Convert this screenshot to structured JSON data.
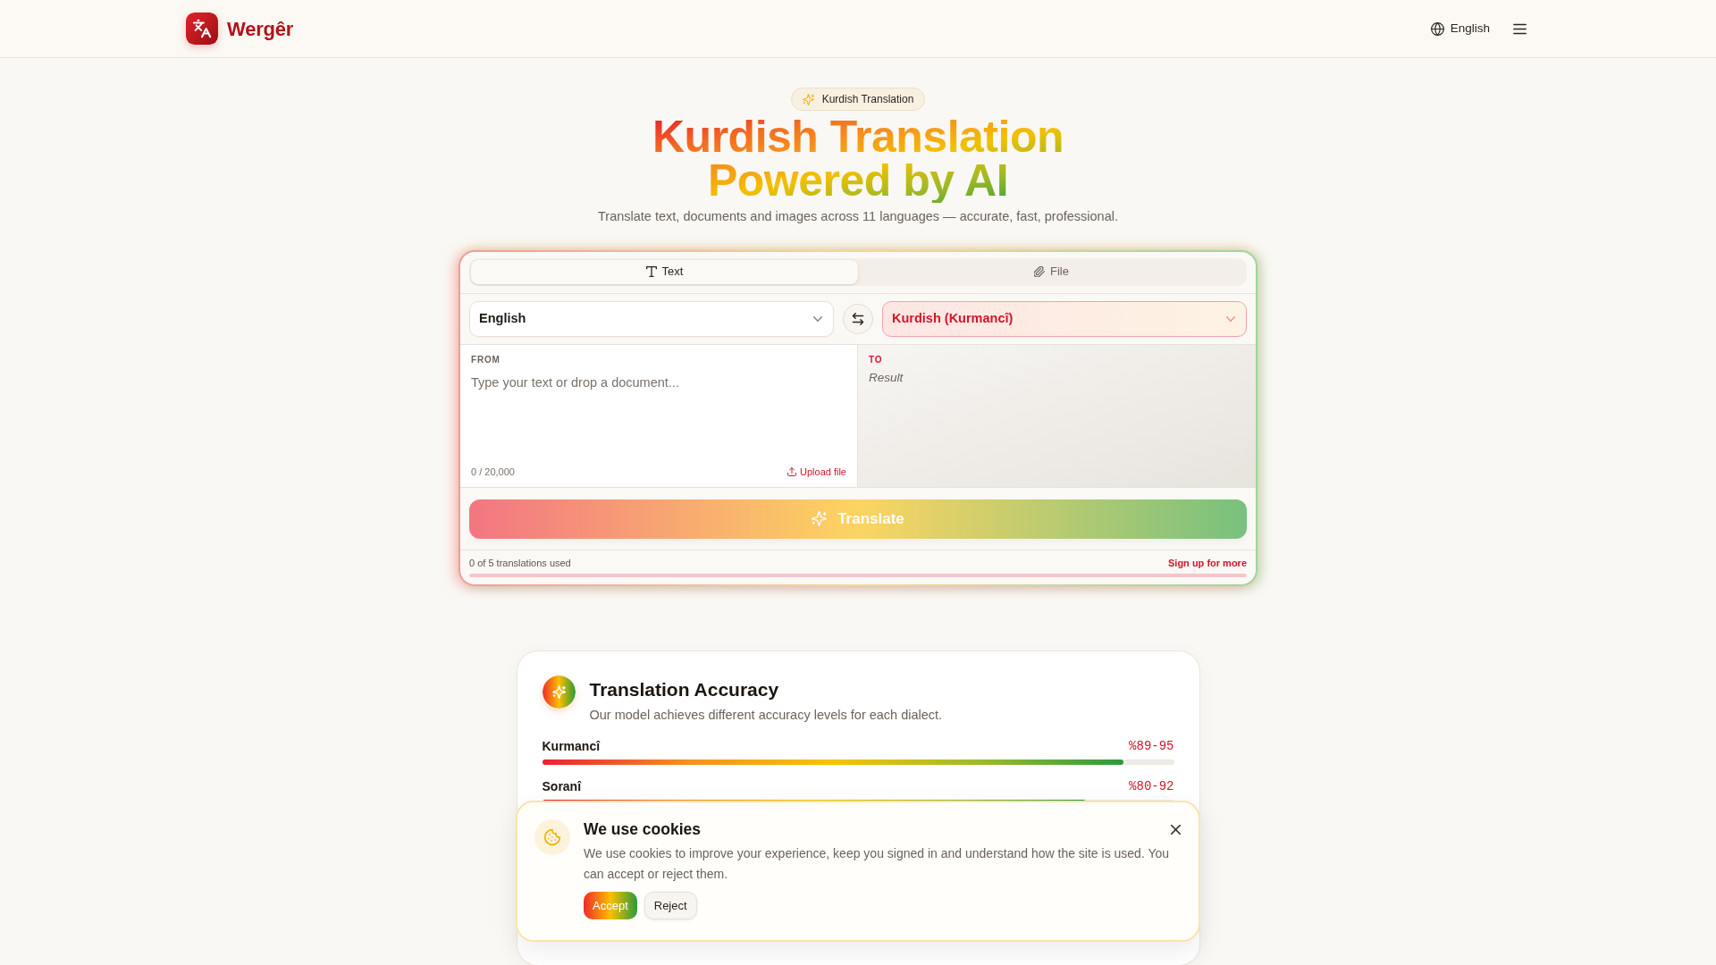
{
  "header": {
    "brand": "Wergêr",
    "language": "English"
  },
  "hero": {
    "badge": "Kurdish Translation",
    "title": "Kurdish Translation Powered by AI",
    "subtitle": "Translate text, documents and images across 11 languages — accurate, fast, professional."
  },
  "translator": {
    "tabs": [
      {
        "label": "Text",
        "kind": "text",
        "selected": true
      },
      {
        "label": "File",
        "kind": "file",
        "selected": false
      }
    ],
    "source_language": "English",
    "target_language": "Kurdish (Kurmancî)",
    "source_panel": {
      "label": "FROM",
      "placeholder": "Type your text or drop a document...",
      "counter": "0 / 20,000",
      "upload": "Upload file"
    },
    "target_panel": {
      "label": "TO",
      "placeholder": "Result"
    },
    "translate_button": {
      "label": "Translate",
      "disabled": true
    },
    "usage": {
      "text": "0 of 5 translations used",
      "link": "Sign up for more",
      "level": 0
    }
  },
  "accuracy": {
    "title": "Translation Accuracy",
    "subtitle": "Our model achieves different accuracy levels for each dialect.",
    "dialects": [
      {
        "name": "Kurmancî",
        "range": "%89-95",
        "level": 0.92
      },
      {
        "name": "Soranî",
        "range": "%80-92",
        "level": 0.86
      }
    ]
  },
  "cookie_banner": {
    "title": "We use cookies",
    "text": "We use cookies to improve your experience, keep you signed in and understand how the site is used. You can accept or reject them.",
    "buttons": [
      {
        "label": "Accept",
        "kind": "primary"
      },
      {
        "label": "Reject",
        "kind": "secondary"
      }
    ]
  }
}
